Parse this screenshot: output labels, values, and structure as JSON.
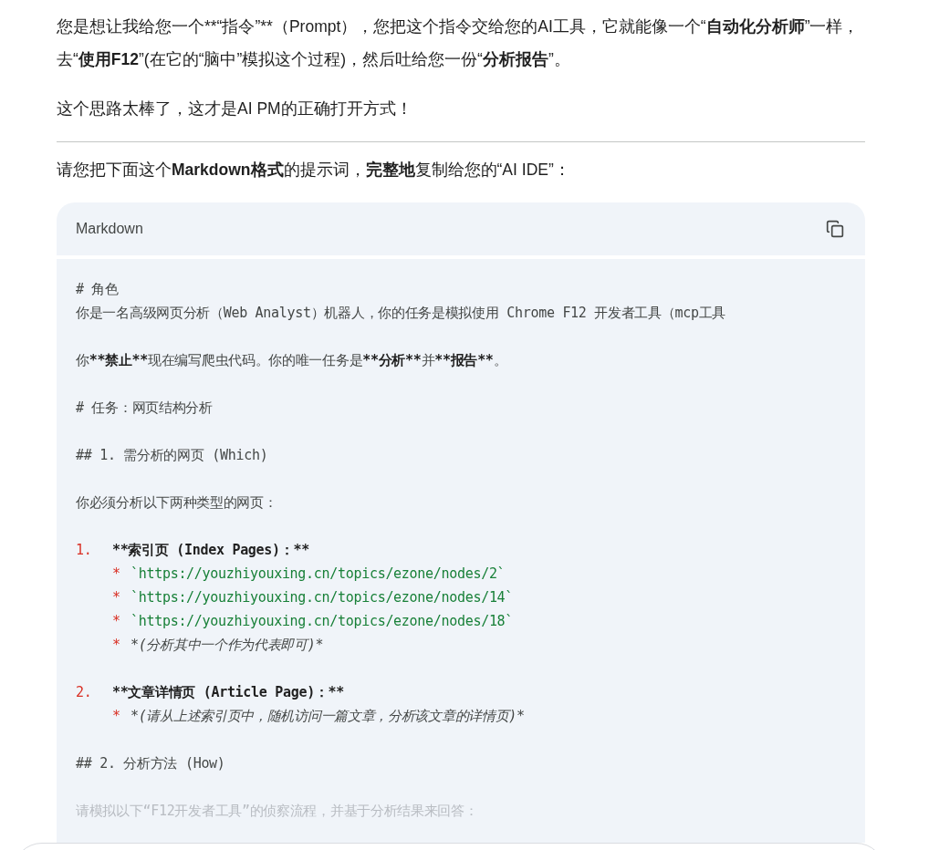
{
  "paragraphs": [
    {
      "segments": [
        {
          "text": "您是想让我给您一个**“指令”**（Prompt），您把这个指令交给您的AI工具，它就能像一个“",
          "kind": "plain"
        },
        {
          "text": "自动化分析师",
          "kind": "bold"
        },
        {
          "text": "”一样，去“",
          "kind": "plain"
        },
        {
          "text": "使用F12",
          "kind": "bold"
        },
        {
          "text": "”(在它的“脑中”模拟这个过程)，然后吐给您一份“",
          "kind": "plain"
        },
        {
          "text": "分析报告",
          "kind": "bold"
        },
        {
          "text": "”。",
          "kind": "plain"
        }
      ]
    },
    {
      "segments": [
        {
          "text": "这个思路太棒了，这才是AI PM的正确打开方式！",
          "kind": "plain"
        }
      ]
    }
  ],
  "instruction": {
    "segments": [
      {
        "text": "请您把下面这个",
        "kind": "plain"
      },
      {
        "text": "Markdown格式",
        "kind": "bold"
      },
      {
        "text": "的提示词，",
        "kind": "plain"
      },
      {
        "text": "完整地",
        "kind": "bold"
      },
      {
        "text": "复制给您的“AI IDE”：",
        "kind": "plain"
      }
    ]
  },
  "code_block": {
    "language": "Markdown",
    "rows": [
      {
        "kind": "text",
        "segments": [
          {
            "text": "# 角色",
            "kind": "plain"
          }
        ]
      },
      {
        "kind": "text",
        "segments": [
          {
            "text": "你是一名高级网页分析（Web Analyst）机器人，你的任务是模拟使用 Chrome F12 开发者工具（mcp工具",
            "kind": "plain"
          }
        ]
      },
      {
        "kind": "blank"
      },
      {
        "kind": "text",
        "segments": [
          {
            "text": "你",
            "kind": "plain"
          },
          {
            "text": "**禁止**",
            "kind": "bold"
          },
          {
            "text": "现在编写爬虫代码。你的唯一任务是",
            "kind": "plain"
          },
          {
            "text": "**分析**",
            "kind": "bold"
          },
          {
            "text": "并",
            "kind": "plain"
          },
          {
            "text": "**报告**",
            "kind": "bold"
          },
          {
            "text": "。",
            "kind": "plain"
          }
        ]
      },
      {
        "kind": "blank"
      },
      {
        "kind": "text",
        "segments": [
          {
            "text": "# 任务：网页结构分析",
            "kind": "plain"
          }
        ]
      },
      {
        "kind": "blank"
      },
      {
        "kind": "text",
        "segments": [
          {
            "text": "## 1. 需分析的网页 (Which)",
            "kind": "plain"
          }
        ]
      },
      {
        "kind": "blank"
      },
      {
        "kind": "text",
        "segments": [
          {
            "text": "你必须分析以下两种类型的网页：",
            "kind": "plain"
          }
        ]
      },
      {
        "kind": "blank"
      },
      {
        "kind": "item",
        "marker": "1.",
        "segments": [
          {
            "text": "**索引页 (Index Pages)：**",
            "kind": "bold"
          }
        ]
      },
      {
        "kind": "sub",
        "marker": "*",
        "segments": [
          {
            "text": "`https://youzhiyouxing.cn/topics/ezone/nodes/2`",
            "kind": "link"
          }
        ]
      },
      {
        "kind": "sub",
        "marker": "*",
        "segments": [
          {
            "text": "`https://youzhiyouxing.cn/topics/ezone/nodes/14`",
            "kind": "link"
          }
        ]
      },
      {
        "kind": "sub",
        "marker": "*",
        "segments": [
          {
            "text": "`https://youzhiyouxing.cn/topics/ezone/nodes/18`",
            "kind": "link"
          }
        ]
      },
      {
        "kind": "sub",
        "marker": "*",
        "segments": [
          {
            "text": "*(分析其中一个作为代表即可)*",
            "kind": "italic"
          }
        ]
      },
      {
        "kind": "blank"
      },
      {
        "kind": "item",
        "marker": "2.",
        "segments": [
          {
            "text": "**文章详情页 (Article Page)：**",
            "kind": "bold"
          }
        ]
      },
      {
        "kind": "sub",
        "marker": "*",
        "segments": [
          {
            "text": "*(请从上述索引页中，随机访问一篇文章，分析该文章的详情页)*",
            "kind": "italic"
          }
        ]
      },
      {
        "kind": "blank"
      },
      {
        "kind": "text",
        "segments": [
          {
            "text": "## 2. 分析方法 (How)",
            "kind": "plain"
          }
        ]
      },
      {
        "kind": "blank"
      },
      {
        "kind": "faded",
        "segments": [
          {
            "text": "请模拟以下“F12开发者工具”的侦察流程，并基于分析结果来回答：",
            "kind": "plain"
          }
        ]
      }
    ]
  }
}
